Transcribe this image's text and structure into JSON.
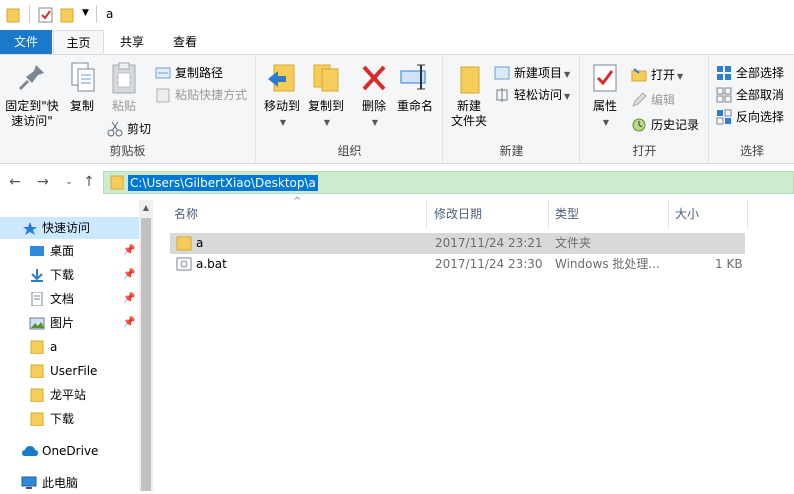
{
  "window": {
    "title": "a"
  },
  "ribbon_tabs": [
    {
      "label": "文件"
    },
    {
      "label": "主页"
    },
    {
      "label": "共享"
    },
    {
      "label": "查看"
    }
  ],
  "clipboard": {
    "pin_label": "固定到\"快\n速访问\"",
    "copy_label": "复制",
    "paste_label": "粘贴",
    "copy_path_label": "复制路径",
    "paste_shortcut_label": "粘贴快捷方式",
    "cut_label": "剪切",
    "group_label": "剪贴板"
  },
  "organize": {
    "move_to_label": "移动到",
    "copy_to_label": "复制到",
    "delete_label": "删除",
    "rename_label": "重命名",
    "group_label": "组织"
  },
  "new": {
    "new_folder_label": "新建\n文件夹",
    "new_item_label": "新建项目",
    "easy_access_label": "轻松访问",
    "group_label": "新建"
  },
  "open": {
    "properties_label": "属性",
    "open_label": "打开",
    "edit_label": "编辑",
    "history_label": "历史记录",
    "group_label": "打开"
  },
  "select": {
    "select_all_label": "全部选择",
    "select_none_label": "全部取消",
    "invert_label": "反向选择",
    "group_label": "选择"
  },
  "address": {
    "path": "C:\\Users\\GilbertXiao\\Desktop\\a"
  },
  "nav_pane": {
    "quick_access": "快速访问",
    "items": [
      {
        "label": "桌面",
        "pinned": true
      },
      {
        "label": "下载",
        "pinned": true
      },
      {
        "label": "文档",
        "pinned": true
      },
      {
        "label": "图片",
        "pinned": true
      },
      {
        "label": "a",
        "pinned": false
      },
      {
        "label": "UserFile",
        "pinned": false
      },
      {
        "label": "龙平站",
        "pinned": false
      },
      {
        "label": "下载",
        "pinned": false
      }
    ],
    "onedrive": "OneDrive",
    "this_pc": "此电脑"
  },
  "file_list": {
    "columns": [
      "名称",
      "修改日期",
      "类型",
      "大小"
    ],
    "rows": [
      {
        "name": "a",
        "modified": "2017/11/24 23:21",
        "type": "文件夹",
        "size": ""
      },
      {
        "name": "a.bat",
        "modified": "2017/11/24 23:30",
        "type": "Windows 批处理...",
        "size": "1 KB"
      }
    ]
  },
  "colors": {
    "accent": "#1979ca",
    "address_bg": "#cdebcf",
    "selection": "#0078d7",
    "folder": "#f6cd5a",
    "delete_red": "#d82c2c"
  }
}
